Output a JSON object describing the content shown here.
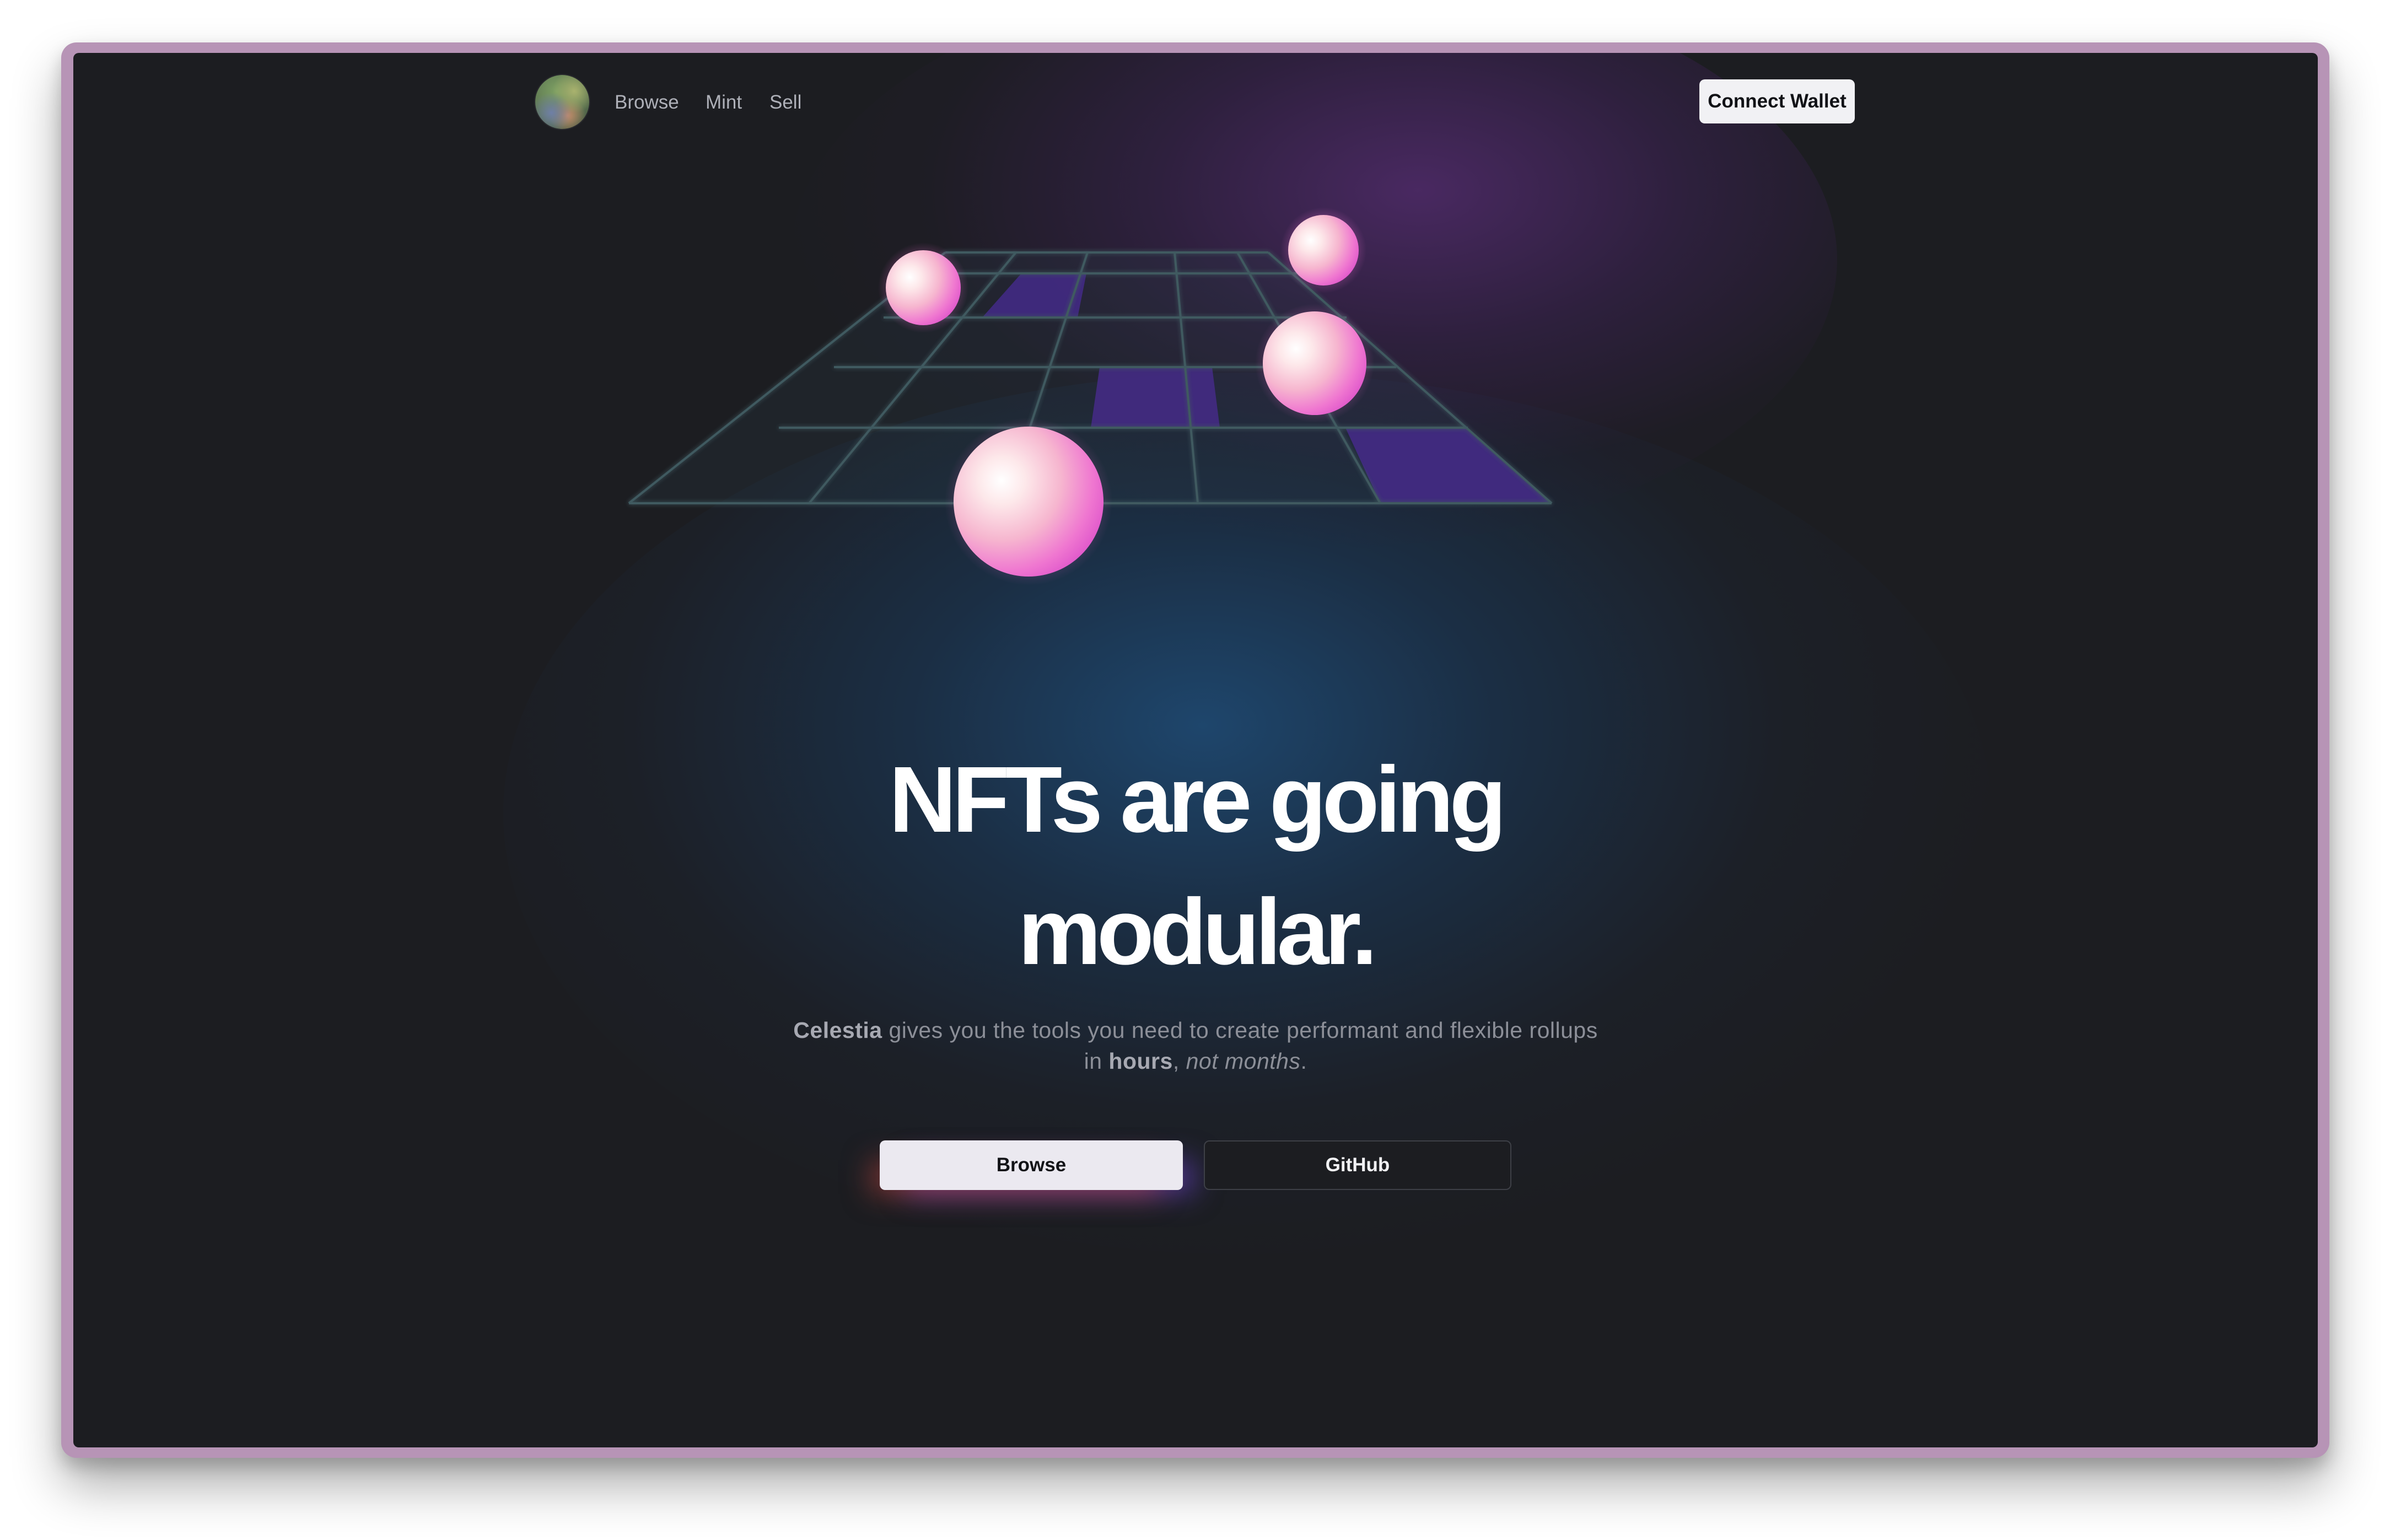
{
  "nav": {
    "logo_name": "logo-avatar",
    "links": [
      "Browse",
      "Mint",
      "Sell"
    ],
    "connect_label": "Connect Wallet"
  },
  "hero": {
    "headline_line1": "NFTs are going",
    "headline_line2": "modular.",
    "sub_bold1": "Celestia",
    "sub_text1": " gives you the tools you need to create performant and flexible rollups in ",
    "sub_bold2": "hours",
    "sub_text2": ", ",
    "sub_italic": "not months",
    "sub_text3": "."
  },
  "buttons": {
    "browse_label": "Browse",
    "github_label": "GitHub"
  },
  "colors": {
    "frame": "#b794b6",
    "background": "#1c1d21",
    "highlight_tile": "#4a2490",
    "sphere_pink": "#f07fd4"
  }
}
